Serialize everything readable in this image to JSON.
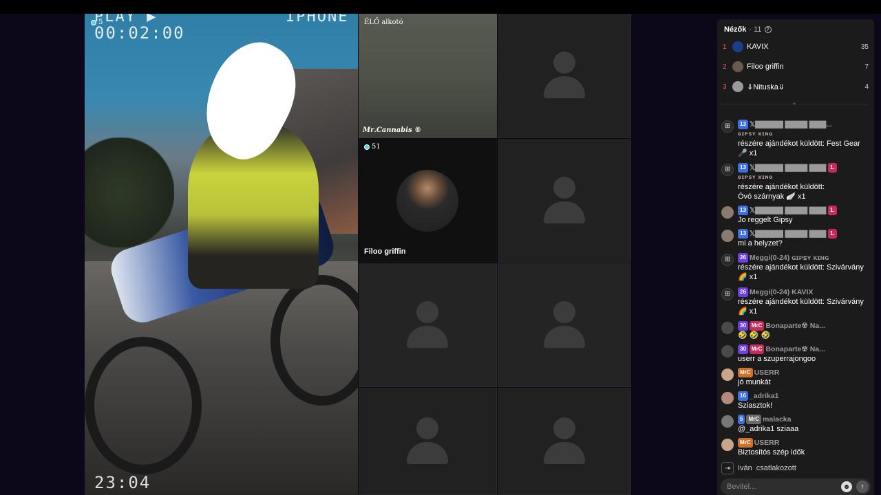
{
  "main_stream": {
    "vhs_play": "PLAY ▶",
    "vhs_time": "00:02:00",
    "vhs_device": "IPHONE",
    "vhs_bottom_time": "23:04",
    "viewer_count": "5"
  },
  "live_tile": {
    "label": "ÉLŐ alkotó",
    "handle": "𝑴𝒓.𝑪𝒂𝒏𝒏𝒂𝒃𝒊𝒔 ®"
  },
  "guest_tile": {
    "viewer_count": "51",
    "name": "Filoo griffin"
  },
  "viewers": {
    "title": "Nézők",
    "count": "· 11",
    "ranking": [
      {
        "rank": "1",
        "name": "KAVIX",
        "score": "35"
      },
      {
        "rank": "2",
        "name": "Filoo griffin",
        "score": "7"
      },
      {
        "rank": "3",
        "name": "⇓Nituska⇓",
        "score": "4"
      }
    ]
  },
  "chat": [
    {
      "type": "gift",
      "level": "13",
      "meta": "𝕏▇▇▇▇▇ ▇▇▇▇ ▇▇▇...",
      "sub": "ɢɪᴘꜱʏ ᴋɪɴɢ",
      "text": "részére ajándékot küldött: Fest Gear",
      "extra": "🎤 x1"
    },
    {
      "type": "gift",
      "level": "13",
      "meta": "𝕏▇▇▇▇▇ ▇▇▇▇ ▇▇▇",
      "badge": "1.",
      "sub": "ɢɪᴘꜱʏ ᴋɪɴɢ",
      "text": "részére ajándékot küldött:",
      "extra": "Óvó szárnyak 🪽 x1"
    },
    {
      "type": "msg",
      "level": "13",
      "meta": "𝕏▇▇▇▇▇ ▇▇▇▇ ▇▇▇",
      "badge": "1.",
      "text": "Jo reggelt Gipsy"
    },
    {
      "type": "msg",
      "level": "13",
      "meta": "𝕏▇▇▇▇▇ ▇▇▇▇ ▇▇▇",
      "badge": "1.",
      "text": "mi a helyzet?"
    },
    {
      "type": "gift",
      "level": "26",
      "meta": "Meggi(0-24) ɢɪᴘꜱʏ ᴋɪɴɢ",
      "text": "részére ajándékot küldött: Szivárvány",
      "extra": "🌈 x1"
    },
    {
      "type": "gift",
      "level": "26",
      "meta": "Meggi(0-24) KAVIX",
      "text": "részére ajándékot küldött: Szivárvány",
      "extra": "🌈 x1"
    },
    {
      "type": "msg",
      "level": "30",
      "fan": "MrC",
      "meta": "Bonaparte☢ Na...",
      "text": "🤣 🤣 🤣"
    },
    {
      "type": "msg",
      "level": "30",
      "fan": "MrC",
      "meta": "Bonaparte☢ Na...",
      "text": "userr a szuperrajongoo"
    },
    {
      "type": "msg",
      "fan": "MrC",
      "meta": "USERR",
      "text": "jó munkát"
    },
    {
      "type": "msg",
      "level": "16",
      "meta": "_adrika1",
      "text": "Sziasztok!"
    },
    {
      "type": "msg",
      "level": "5",
      "fan": "MrC",
      "meta": "malacka",
      "text": "@_adrika1 sziaaa"
    },
    {
      "type": "msg",
      "fan": "MrC",
      "meta": "USERR",
      "text": "Biztosítós szép idők"
    }
  ],
  "join_event": {
    "name": "Iván",
    "text": "csatlakozott"
  },
  "input": {
    "placeholder": "Bevitel..."
  },
  "icons": {
    "emoji": "emoji-icon",
    "send": "arrow-up-icon",
    "gift": "gift-icon",
    "join": "join-icon"
  }
}
